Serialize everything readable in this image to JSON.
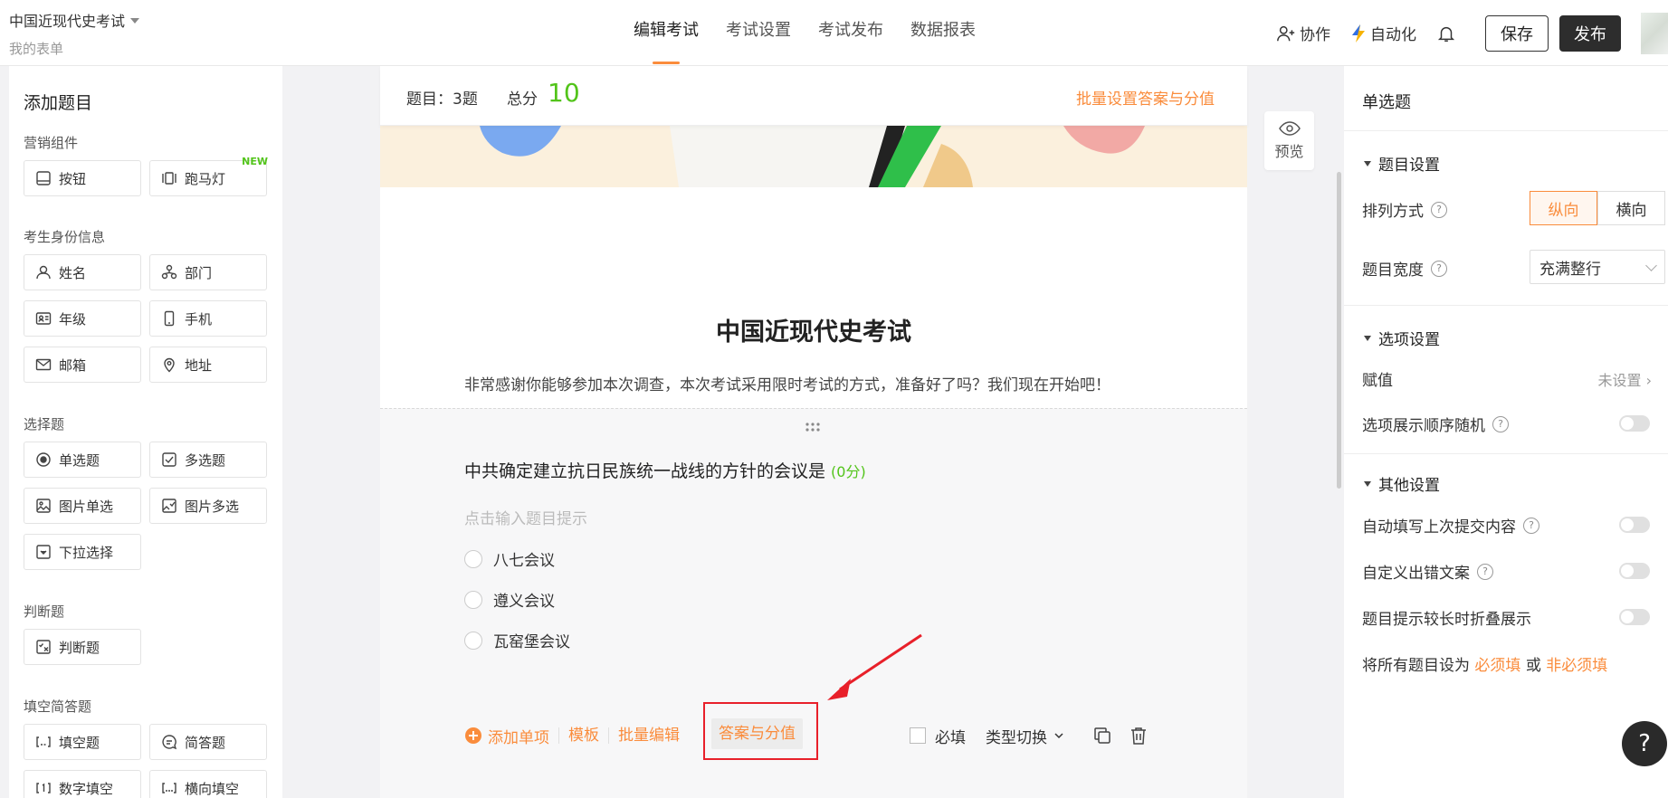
{
  "header": {
    "form_title": "中国近现代史考试",
    "form_subtitle": "我的表单",
    "tabs": [
      "编辑考试",
      "考试设置",
      "考试发布",
      "数据报表"
    ],
    "active_tab": "编辑考试",
    "collab": "协作",
    "automation": "自动化",
    "save": "保存",
    "publish": "发布"
  },
  "left": {
    "title": "添加题目",
    "sections": [
      {
        "title": "营销组件",
        "items": [
          {
            "label": "按钮",
            "icon": "button-icon"
          },
          {
            "label": "跑马灯",
            "icon": "marquee-icon",
            "badge": "NEW"
          }
        ]
      },
      {
        "title": "考生身份信息",
        "items": [
          {
            "label": "姓名",
            "icon": "user-icon"
          },
          {
            "label": "部门",
            "icon": "org-icon"
          },
          {
            "label": "年级",
            "icon": "id-card-icon"
          },
          {
            "label": "手机",
            "icon": "phone-icon"
          },
          {
            "label": "邮箱",
            "icon": "mail-icon"
          },
          {
            "label": "地址",
            "icon": "location-icon"
          }
        ]
      },
      {
        "title": "选择题",
        "items": [
          {
            "label": "单选题",
            "icon": "radio-icon"
          },
          {
            "label": "多选题",
            "icon": "checkbox-icon"
          },
          {
            "label": "图片单选",
            "icon": "image-icon"
          },
          {
            "label": "图片多选",
            "icon": "image-multi-icon"
          },
          {
            "label": "下拉选择",
            "icon": "dropdown-icon"
          }
        ]
      },
      {
        "title": "判断题",
        "items": [
          {
            "label": "判断题",
            "icon": "judge-icon"
          }
        ]
      },
      {
        "title": "填空简答题",
        "items": [
          {
            "label": "填空题",
            "icon": "blank-icon"
          },
          {
            "label": "简答题",
            "icon": "answer-icon"
          },
          {
            "label": "数字填空",
            "icon": "number-icon"
          },
          {
            "label": "横向填空",
            "icon": "horizontal-blank-icon"
          }
        ]
      }
    ]
  },
  "summary": {
    "count": "题目：3题",
    "total_label": "总分",
    "total": "10",
    "batch": "批量设置答案与分值"
  },
  "exam": {
    "title": "中国近现代史考试",
    "desc": "非常感谢你能够参加本次调查，本次考试采用限时考试的方式，准备好了吗？我们现在开始吧！"
  },
  "question": {
    "title": "中共确定建立抗日民族统一战线的方针的会议是",
    "score": "(0分)",
    "hint": "点击输入题目提示",
    "options": [
      "八七会议",
      "遵义会议",
      "瓦窑堡会议"
    ],
    "toolbar": {
      "add": "添加单项",
      "template": "模板",
      "batch_edit": "批量编辑",
      "answer": "答案与分值",
      "required": "必填",
      "switch": "类型切换"
    }
  },
  "preview": "预览",
  "right": {
    "title": "单选题",
    "sec1": "题目设置",
    "layout_label": "排列方式",
    "layout_opts": [
      "纵向",
      "横向"
    ],
    "width_label": "题目宽度",
    "width_val": "充满整行",
    "sec2": "选项设置",
    "assign_label": "赋值",
    "assign_val": "未设置",
    "random_label": "选项展示顺序随机",
    "sec3": "其他设置",
    "autofill_label": "自动填写上次提交内容",
    "error_label": "自定义出错文案",
    "fold_label": "题目提示较长时折叠展示",
    "bottom_prefix": "将所有题目设为",
    "bottom_req": "必须填",
    "bottom_or": "或",
    "bottom_notreq": "非必须填"
  },
  "help": "?"
}
